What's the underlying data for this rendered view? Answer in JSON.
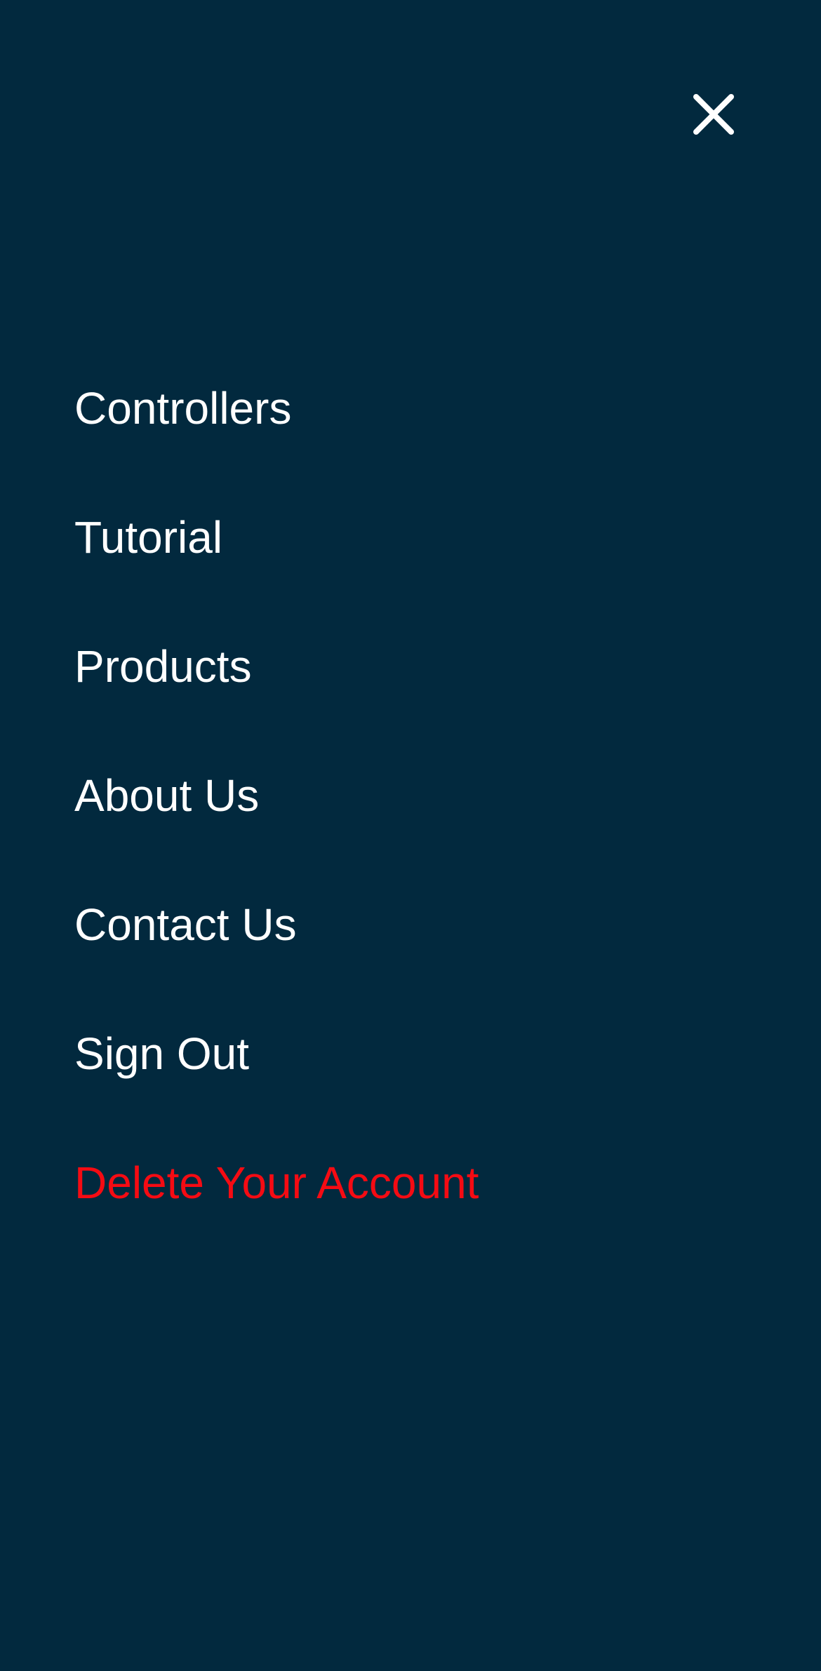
{
  "header": {
    "close_icon": "close-icon",
    "close_label": "Close menu"
  },
  "menu": {
    "items": [
      {
        "label": "Controllers"
      },
      {
        "label": "Tutorial"
      },
      {
        "label": "Products"
      },
      {
        "label": "About Us"
      },
      {
        "label": "Contact Us"
      },
      {
        "label": "Sign Out"
      },
      {
        "label": "Delete Your Account"
      }
    ]
  },
  "colors": {
    "background": "#02293e",
    "text": "#ffffff",
    "danger": "#f50b13"
  }
}
